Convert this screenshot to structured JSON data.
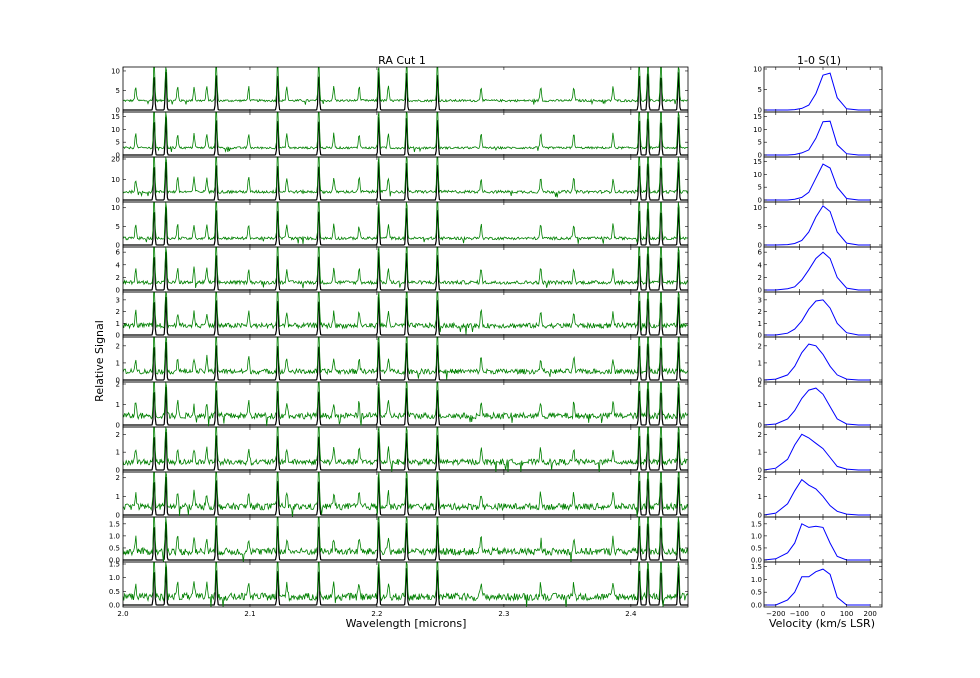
{
  "chart_data": [
    {
      "type": "line",
      "title": "RA Cut 1",
      "xlabel": "Wavelength [microns]",
      "ylabel": "Relative Signal",
      "xlim": [
        2.0,
        2.445
      ],
      "x_ticks": [
        "2.0",
        "2.1",
        "2.2",
        "2.3",
        "2.4"
      ],
      "x_tick_values": [
        2.0,
        2.1,
        2.2,
        2.3,
        2.4
      ],
      "series_colors": {
        "spectrum": "#008000",
        "model": "#000000"
      },
      "line_wavelengths": [
        2.0245,
        2.0338,
        2.0735,
        2.1218,
        2.1542,
        2.2014,
        2.2233,
        2.2477,
        2.4066,
        2.4134,
        2.4237,
        2.4375
      ],
      "minor_line_wavelengths": [
        2.01,
        2.043,
        2.056,
        2.066,
        2.099,
        2.129,
        2.166,
        2.186,
        2.209,
        2.282,
        2.329,
        2.355,
        2.386
      ],
      "panels": [
        {
          "ylim": [
            0,
            10.5
          ],
          "yticks": [
            "0",
            "5",
            "10"
          ],
          "ytick_values": [
            0,
            5,
            10
          ],
          "baseline": 2.4
        },
        {
          "ylim": [
            0,
            16
          ],
          "yticks": [
            "0",
            "5",
            "10",
            "15"
          ],
          "ytick_values": [
            0,
            5,
            10,
            15
          ],
          "baseline": 2.8
        },
        {
          "ylim": [
            0,
            20
          ],
          "yticks": [
            "0",
            "10",
            "20"
          ],
          "ytick_values": [
            0,
            10,
            20
          ],
          "baseline": 4.0
        },
        {
          "ylim": [
            0,
            11
          ],
          "yticks": [
            "0",
            "5",
            "10"
          ],
          "ytick_values": [
            0,
            5,
            10
          ],
          "baseline": 1.8
        },
        {
          "ylim": [
            0,
            6.5
          ],
          "yticks": [
            "0",
            "2",
            "4",
            "6"
          ],
          "ytick_values": [
            0,
            2,
            4,
            6
          ],
          "baseline": 1.2
        },
        {
          "ylim": [
            0,
            3.5
          ],
          "yticks": [
            "0",
            "1",
            "2",
            "3"
          ],
          "ytick_values": [
            0,
            1,
            2,
            3
          ],
          "baseline": 0.8
        },
        {
          "ylim": [
            0,
            2.4
          ],
          "yticks": [
            "0",
            "1",
            "2"
          ],
          "ytick_values": [
            0,
            1,
            2
          ],
          "baseline": 0.5
        },
        {
          "ylim": [
            0,
            2.0
          ],
          "yticks": [
            "0",
            "1",
            "2"
          ],
          "ytick_values": [
            0,
            1,
            2
          ],
          "baseline": 0.45
        },
        {
          "ylim": [
            0,
            2.3
          ],
          "yticks": [
            "0",
            "1",
            "2"
          ],
          "ytick_values": [
            0,
            1,
            2
          ],
          "baseline": 0.45
        },
        {
          "ylim": [
            0,
            2.2
          ],
          "yticks": [
            "0",
            "1",
            "2"
          ],
          "ytick_values": [
            0,
            1,
            2
          ],
          "baseline": 0.45
        },
        {
          "ylim": [
            0,
            1.7
          ],
          "yticks": [
            "0.0",
            "0.5",
            "1.0",
            "1.5"
          ],
          "ytick_values": [
            0,
            0.5,
            1.0,
            1.5
          ],
          "baseline": 0.35
        },
        {
          "ylim": [
            0,
            1.5
          ],
          "yticks": [
            "0.0",
            "0.5",
            "1.0",
            "1.5"
          ],
          "ytick_values": [
            0,
            0.5,
            1.0,
            1.5
          ],
          "baseline": 0.3
        }
      ]
    },
    {
      "type": "line",
      "title": "1-0 S(1)",
      "xlabel": "Velocity (km/s LSR)",
      "xlim": [
        -250,
        250
      ],
      "x_ticks": [
        "−200",
        "−100",
        "0",
        "100",
        "200"
      ],
      "x_tick_values": [
        -200,
        -100,
        0,
        100,
        200
      ],
      "series_colors": {
        "profile": "#0000ff"
      },
      "velocity": [
        -250,
        -200,
        -150,
        -120,
        -90,
        -60,
        -30,
        0,
        30,
        60,
        100,
        150,
        200
      ],
      "panels": [
        {
          "ylim": [
            0,
            10
          ],
          "yticks": [
            "0",
            "5",
            "10"
          ],
          "ytick_values": [
            0,
            5,
            10
          ],
          "values": [
            0.0,
            0.0,
            0.0,
            0.1,
            0.4,
            1.2,
            4.0,
            8.5,
            9.0,
            3.0,
            0.3,
            0.0,
            0.0
          ]
        },
        {
          "ylim": [
            0,
            16
          ],
          "yticks": [
            "0",
            "5",
            "10",
            "15"
          ],
          "ytick_values": [
            0,
            5,
            10,
            15
          ],
          "values": [
            0.0,
            0.0,
            0.0,
            0.2,
            0.8,
            2.0,
            6.5,
            13.0,
            13.2,
            4.0,
            0.5,
            0.0,
            0.0
          ]
        },
        {
          "ylim": [
            0,
            16
          ],
          "yticks": [
            "0",
            "5",
            "10",
            "15"
          ],
          "ytick_values": [
            0,
            5,
            10,
            15
          ],
          "values": [
            0.0,
            0.0,
            0.0,
            0.3,
            1.0,
            3.0,
            8.5,
            14.0,
            12.5,
            5.0,
            0.6,
            0.0,
            0.0
          ]
        },
        {
          "ylim": [
            0,
            11
          ],
          "yticks": [
            "0",
            "5",
            "10"
          ],
          "ytick_values": [
            0,
            5,
            10
          ],
          "values": [
            0.0,
            0.0,
            0.1,
            0.4,
            1.2,
            3.5,
            7.5,
            10.5,
            9.0,
            3.5,
            0.5,
            0.0,
            0.0
          ]
        },
        {
          "ylim": [
            0,
            6.5
          ],
          "yticks": [
            "0",
            "2",
            "4",
            "6"
          ],
          "ytick_values": [
            0,
            2,
            4,
            6
          ],
          "values": [
            0.0,
            0.0,
            0.2,
            0.5,
            1.6,
            3.2,
            5.0,
            6.0,
            5.0,
            2.0,
            0.3,
            0.0,
            0.0
          ]
        },
        {
          "ylim": [
            0,
            3.5
          ],
          "yticks": [
            "0",
            "1",
            "2",
            "3"
          ],
          "ytick_values": [
            0,
            1,
            2,
            3
          ],
          "values": [
            0.0,
            0.0,
            0.15,
            0.5,
            1.2,
            2.2,
            2.9,
            3.0,
            2.3,
            1.0,
            0.2,
            0.0,
            0.0
          ]
        },
        {
          "ylim": [
            0,
            2.4
          ],
          "yticks": [
            "0",
            "1",
            "2"
          ],
          "ytick_values": [
            0,
            1,
            2
          ],
          "values": [
            0.0,
            0.05,
            0.3,
            0.8,
            1.6,
            2.1,
            2.0,
            1.5,
            0.8,
            0.3,
            0.05,
            0.0,
            0.0
          ]
        },
        {
          "ylim": [
            0,
            2.0
          ],
          "yticks": [
            "0",
            "1",
            "2"
          ],
          "ytick_values": [
            0,
            1,
            2
          ],
          "values": [
            0.0,
            0.05,
            0.3,
            0.7,
            1.3,
            1.7,
            1.8,
            1.5,
            0.9,
            0.3,
            0.05,
            0.0,
            0.0
          ]
        },
        {
          "ylim": [
            0,
            2.3
          ],
          "yticks": [
            "0",
            "1",
            "2"
          ],
          "ytick_values": [
            0,
            1,
            2
          ],
          "values": [
            0.0,
            0.1,
            0.6,
            1.4,
            2.0,
            1.8,
            1.5,
            1.2,
            0.7,
            0.2,
            0.05,
            0.0,
            0.0
          ]
        },
        {
          "ylim": [
            0,
            2.2
          ],
          "yticks": [
            "0",
            "1",
            "2"
          ],
          "ytick_values": [
            0,
            1,
            2
          ],
          "values": [
            0.0,
            0.1,
            0.6,
            1.3,
            1.9,
            1.6,
            1.4,
            1.0,
            0.5,
            0.2,
            0.05,
            0.0,
            0.0
          ]
        },
        {
          "ylim": [
            0,
            1.7
          ],
          "yticks": [
            "0.0",
            "0.5",
            "1.0",
            "1.5"
          ],
          "ytick_values": [
            0,
            0.5,
            1.0,
            1.5
          ],
          "values": [
            0.0,
            0.05,
            0.3,
            0.7,
            1.5,
            1.35,
            1.4,
            1.35,
            0.7,
            0.15,
            0.0,
            0.0,
            0.0
          ]
        },
        {
          "ylim": [
            0,
            1.6
          ],
          "yticks": [
            "0.0",
            "0.5",
            "1.0",
            "1.5"
          ],
          "ytick_values": [
            0,
            0.5,
            1.0,
            1.5
          ],
          "values": [
            0.0,
            0.0,
            0.2,
            0.5,
            1.1,
            1.1,
            1.3,
            1.4,
            1.2,
            0.3,
            0.0,
            0.0,
            0.0
          ]
        }
      ]
    }
  ]
}
